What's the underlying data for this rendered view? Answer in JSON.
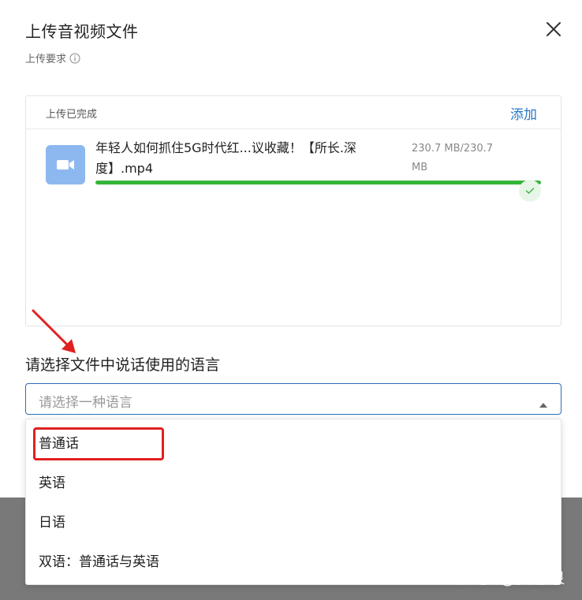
{
  "dialog": {
    "title": "上传音视频文件",
    "requirements_label": "上传要求",
    "close_icon": "close-icon",
    "info_icon": "info-icon"
  },
  "upload": {
    "status_text": "上传已完成",
    "add_label": "添加",
    "file": {
      "name": "年轻人如何抓住5G时代红...议收藏！【所长.深度】.mp4",
      "size": "230.7 MB/230.7 MB",
      "progress": 1.0,
      "thumb_icon": "video-camera-icon",
      "status_icon": "check-icon"
    }
  },
  "language": {
    "label": "请选择文件中说话使用的语言",
    "placeholder": "请选择一种语言",
    "caret_icon": "caret-up-icon",
    "options": [
      "普通话",
      "英语",
      "日语",
      "双语：普通话与英语"
    ]
  },
  "watermark": "知乎 @贵志泉",
  "colors": {
    "accent": "#2e6fb8",
    "link": "#2a78c9",
    "progress": "#35b537",
    "annotation": "#e02020",
    "thumb": "#8cb8ef"
  }
}
